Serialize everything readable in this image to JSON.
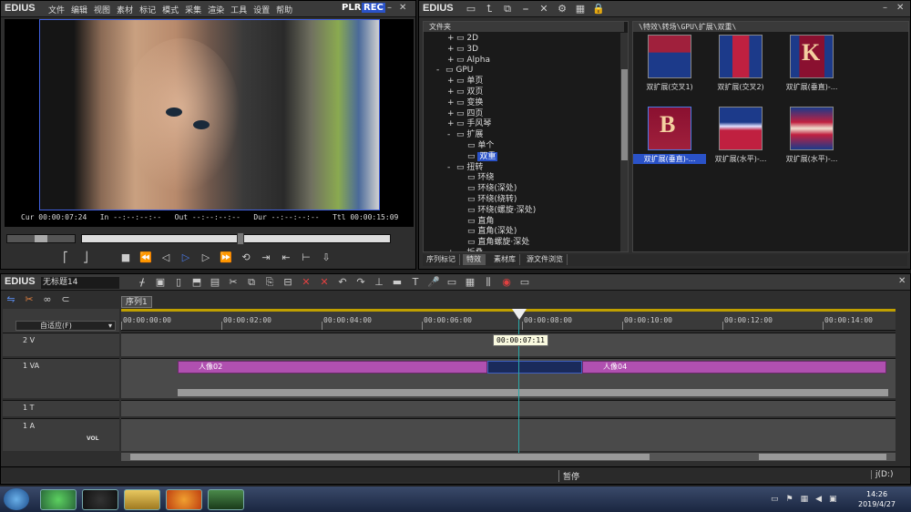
{
  "player": {
    "logo": "EDIUS",
    "menu": [
      "文件",
      "编辑",
      "视图",
      "素材",
      "标记",
      "模式",
      "采集",
      "渲染",
      "工具",
      "设置",
      "帮助"
    ],
    "plr": "PLR",
    "rec": "REC",
    "cur_label": "Cur",
    "cur_value": "00:00:07:24",
    "in_label": "In",
    "in_value": "--:--:--:--",
    "out_label": "Out",
    "out_value": "--:--:--:--",
    "dur_label": "Dur",
    "dur_value": "--:--:--:--",
    "ttl_label": "Ttl",
    "ttl_value": "00:00:15:09"
  },
  "library": {
    "logo": "EDIUS",
    "folder_header": "文件夹",
    "path": "\\特效\\转场\\GPU\\扩展\\双重\\",
    "tree": [
      {
        "label": "2D",
        "indent": 2,
        "expander": "+"
      },
      {
        "label": "3D",
        "indent": 2,
        "expander": "+"
      },
      {
        "label": "Alpha",
        "indent": 2,
        "expander": "+"
      },
      {
        "label": "GPU",
        "indent": 1,
        "expander": "-"
      },
      {
        "label": "单页",
        "indent": 2,
        "expander": "+"
      },
      {
        "label": "双页",
        "indent": 2,
        "expander": "+"
      },
      {
        "label": "变换",
        "indent": 2,
        "expander": "+"
      },
      {
        "label": "四页",
        "indent": 2,
        "expander": "+"
      },
      {
        "label": "手风琴",
        "indent": 2,
        "expander": "+"
      },
      {
        "label": "扩展",
        "indent": 2,
        "expander": "-"
      },
      {
        "label": "单个",
        "indent": 3,
        "expander": ""
      },
      {
        "label": "双重",
        "indent": 3,
        "expander": "",
        "selected": true
      },
      {
        "label": "扭转",
        "indent": 2,
        "expander": "-"
      },
      {
        "label": "环绕",
        "indent": 3,
        "expander": ""
      },
      {
        "label": "环绕(深处)",
        "indent": 3,
        "expander": ""
      },
      {
        "label": "环绕(绕转)",
        "indent": 3,
        "expander": ""
      },
      {
        "label": "环绕(螺旋·深处)",
        "indent": 3,
        "expander": ""
      },
      {
        "label": "直角",
        "indent": 3,
        "expander": ""
      },
      {
        "label": "直角(深处)",
        "indent": 3,
        "expander": ""
      },
      {
        "label": "直角螺旋·深处",
        "indent": 3,
        "expander": ""
      },
      {
        "label": "折叠",
        "indent": 2,
        "expander": "+"
      }
    ],
    "thumbs": [
      {
        "label": "双扩展(交叉1)",
        "letter": "",
        "selected": false
      },
      {
        "label": "双扩展(交叉2)",
        "letter": "",
        "selected": false
      },
      {
        "label": "双扩展(垂直)-...",
        "letter": "K",
        "selected": false
      },
      {
        "label": "双扩展(垂直)-...",
        "letter": "B",
        "selected": true
      },
      {
        "label": "双扩展(水平)-...",
        "letter": "",
        "selected": false
      },
      {
        "label": "双扩展(水平)-...",
        "letter": "",
        "selected": false
      }
    ],
    "bottom_tabs": [
      "序列标记",
      "特效",
      "素材库",
      "源文件浏览"
    ]
  },
  "timeline": {
    "logo": "EDIUS",
    "project_name": "无标题14",
    "sequence_tab": "序列1",
    "fit_label": "自适应(F)",
    "ruler": [
      "00:00:00:00",
      "00:00:02:00",
      "00:00:04:00",
      "00:00:06:00",
      "00:00:08:00",
      "00:00:10:00",
      "00:00:12:00",
      "00:00:14:00"
    ],
    "playhead_tooltip": "00:00:07:11",
    "tracks": [
      {
        "name": "2 V",
        "type": "V"
      },
      {
        "name": "1 VA",
        "type": "VA"
      },
      {
        "name": "1 T",
        "type": "T"
      },
      {
        "name": "1 A",
        "type": "A",
        "vol": "VOL"
      }
    ],
    "clips": [
      {
        "label": "人像02"
      },
      {
        "label": "人像04"
      }
    ],
    "status": "暂停",
    "disk": "j(D:)"
  },
  "taskbar": {
    "time": "14:26",
    "date": "2019/4/27"
  },
  "colors": {
    "accent": "#3a6ae8",
    "clip": "#b050b0",
    "rec": "#2a52c8"
  }
}
